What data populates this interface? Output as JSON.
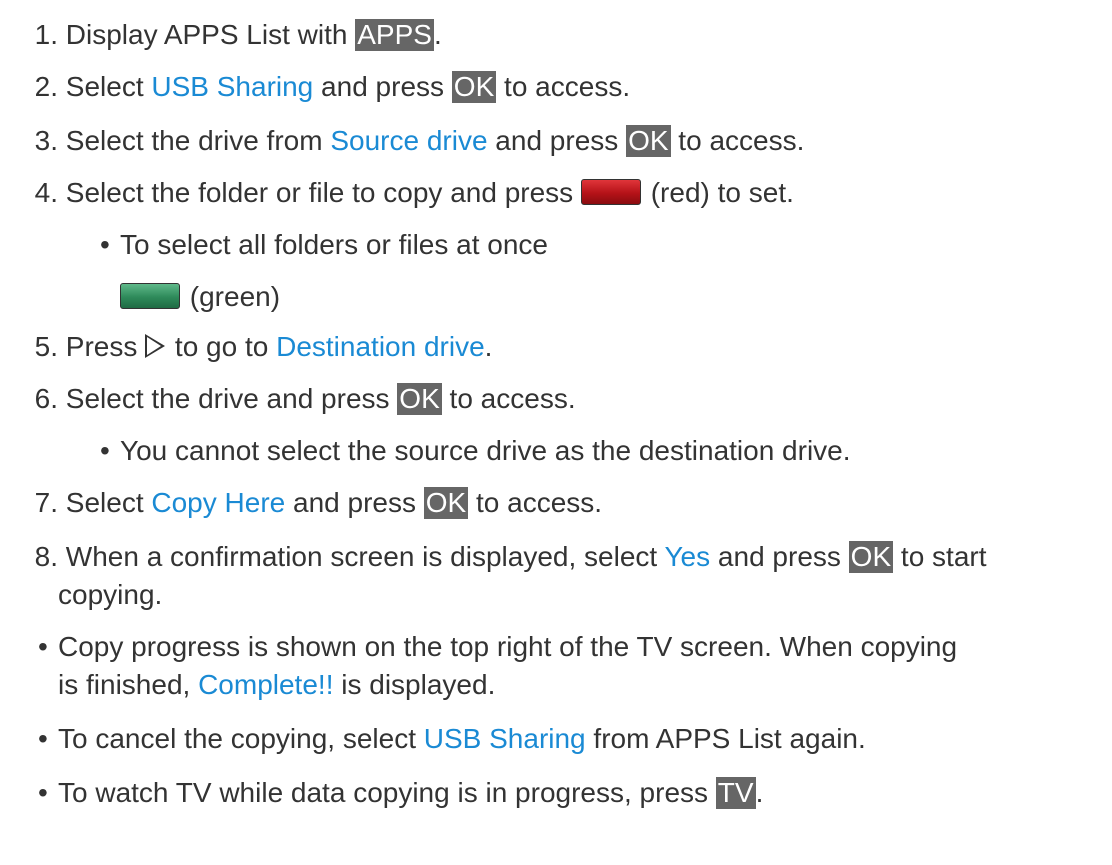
{
  "steps": {
    "s1": {
      "num": "1.",
      "a": "Display APPS List with ",
      "key": "APPS",
      "b": "."
    },
    "s2": {
      "num": "2.",
      "a": "Select ",
      "link": "USB Sharing",
      "b": " and press ",
      "key": "OK",
      "c": " to access."
    },
    "s3": {
      "num": "3.",
      "a": "Select the drive from ",
      "link": "Source drive",
      "b": " and press ",
      "key": "OK",
      "c": " to access."
    },
    "s4": {
      "num": "4.",
      "a": "Select the folder or file to copy and press ",
      "b": "(red) to set."
    },
    "s4_bullet": {
      "text": "To select all folders or files at once",
      "green_text": "(green)"
    },
    "s5": {
      "num": "5.",
      "a": "Press ",
      "b": "to go to ",
      "link": "Destination drive",
      "c": "."
    },
    "s6": {
      "num": "6.",
      "a": "Select the drive and press ",
      "key": "OK",
      "b": " to access."
    },
    "s6_bullet": {
      "text": "You cannot select the source drive as the destination drive."
    },
    "s7": {
      "num": "7.",
      "a": "Select ",
      "link": "Copy Here",
      "b": " and press ",
      "key": "OK",
      "c": " to access."
    },
    "s8": {
      "num": "8.",
      "a": "When a confirmation screen is displayed, select ",
      "link": "Yes",
      "b": " and press ",
      "key": "OK",
      "c": " to start",
      "line2": "copying."
    }
  },
  "notes": {
    "n1": {
      "a": "Copy progress is shown on the top right of the TV screen. When copying",
      "b": "is finished, ",
      "link": "Complete!!",
      "c": " is displayed."
    },
    "n2": {
      "a": "To cancel the copying, select ",
      "link": "USB Sharing",
      "b": " from APPS List again."
    },
    "n3": {
      "a": "To watch TV while data copying is in progress, press ",
      "key": "TV",
      "b": "."
    }
  },
  "bullet_glyph": "•",
  "colors": {
    "link": "#1a8ad4",
    "key_bg": "#666666",
    "red_button": "#b51218",
    "green_button": "#2e8a5a"
  }
}
